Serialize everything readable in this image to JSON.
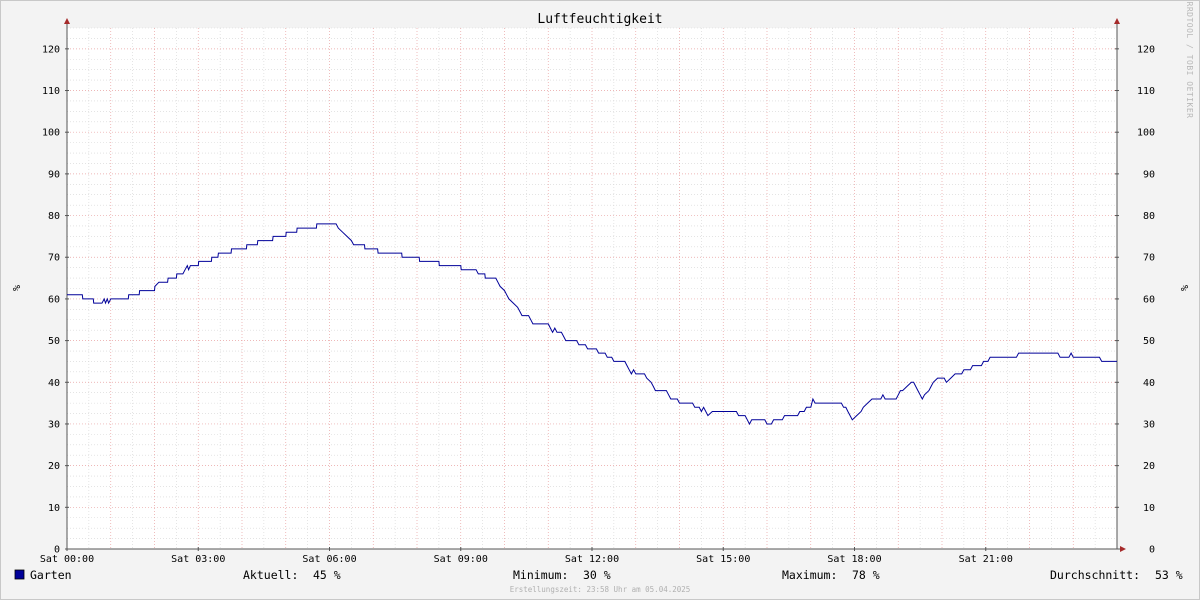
{
  "chart_data": {
    "type": "line",
    "title": "Luftfeuchtigkeit",
    "ylabel": "%",
    "ylim": [
      0,
      125
    ],
    "y_ticks": [
      0,
      10,
      20,
      30,
      40,
      50,
      60,
      70,
      80,
      90,
      100,
      110,
      120
    ],
    "xlim": [
      0,
      24
    ],
    "x_ticks": [
      {
        "x": 0,
        "label": "Sat 00:00"
      },
      {
        "x": 3,
        "label": "Sat 03:00"
      },
      {
        "x": 6,
        "label": "Sat 06:00"
      },
      {
        "x": 9,
        "label": "Sat 09:00"
      },
      {
        "x": 12,
        "label": "Sat 12:00"
      },
      {
        "x": 15,
        "label": "Sat 15:00"
      },
      {
        "x": 18,
        "label": "Sat 18:00"
      },
      {
        "x": 21,
        "label": "Sat 21:00"
      }
    ],
    "grid": true,
    "series": [
      {
        "name": "Garten",
        "color": "#000099",
        "points": [
          [
            0.0,
            61
          ],
          [
            0.35,
            61
          ],
          [
            0.36,
            60
          ],
          [
            0.6,
            60
          ],
          [
            0.61,
            59
          ],
          [
            0.8,
            59
          ],
          [
            0.85,
            60
          ],
          [
            0.88,
            59
          ],
          [
            0.92,
            60
          ],
          [
            0.95,
            59
          ],
          [
            1.0,
            60
          ],
          [
            1.4,
            60
          ],
          [
            1.41,
            61
          ],
          [
            1.65,
            61
          ],
          [
            1.66,
            62
          ],
          [
            2.0,
            62
          ],
          [
            2.01,
            63
          ],
          [
            2.1,
            64
          ],
          [
            2.3,
            64
          ],
          [
            2.31,
            65
          ],
          [
            2.5,
            65
          ],
          [
            2.51,
            66
          ],
          [
            2.65,
            66
          ],
          [
            2.7,
            67
          ],
          [
            2.75,
            68
          ],
          [
            2.78,
            67
          ],
          [
            2.82,
            68
          ],
          [
            3.0,
            68
          ],
          [
            3.01,
            69
          ],
          [
            3.3,
            69
          ],
          [
            3.31,
            70
          ],
          [
            3.45,
            70
          ],
          [
            3.46,
            71
          ],
          [
            3.75,
            71
          ],
          [
            3.76,
            72
          ],
          [
            4.1,
            72
          ],
          [
            4.11,
            73
          ],
          [
            4.35,
            73
          ],
          [
            4.36,
            74
          ],
          [
            4.7,
            74
          ],
          [
            4.71,
            75
          ],
          [
            5.0,
            75
          ],
          [
            5.01,
            76
          ],
          [
            5.25,
            76
          ],
          [
            5.26,
            77
          ],
          [
            5.7,
            77
          ],
          [
            5.71,
            78
          ],
          [
            6.15,
            78
          ],
          [
            6.2,
            77
          ],
          [
            6.3,
            76
          ],
          [
            6.4,
            75
          ],
          [
            6.5,
            74
          ],
          [
            6.55,
            73
          ],
          [
            6.8,
            73
          ],
          [
            6.81,
            72
          ],
          [
            7.1,
            72
          ],
          [
            7.11,
            71
          ],
          [
            7.65,
            71
          ],
          [
            7.66,
            70
          ],
          [
            8.05,
            70
          ],
          [
            8.06,
            69
          ],
          [
            8.5,
            69
          ],
          [
            8.51,
            68
          ],
          [
            9.0,
            68
          ],
          [
            9.01,
            67
          ],
          [
            9.35,
            67
          ],
          [
            9.4,
            66
          ],
          [
            9.55,
            66
          ],
          [
            9.56,
            65
          ],
          [
            9.8,
            65
          ],
          [
            9.85,
            64
          ],
          [
            9.9,
            63
          ],
          [
            10.0,
            62
          ],
          [
            10.05,
            61
          ],
          [
            10.1,
            60
          ],
          [
            10.2,
            59
          ],
          [
            10.3,
            58
          ],
          [
            10.35,
            57
          ],
          [
            10.4,
            56
          ],
          [
            10.55,
            56
          ],
          [
            10.6,
            55
          ],
          [
            10.65,
            54
          ],
          [
            11.0,
            54
          ],
          [
            11.05,
            53
          ],
          [
            11.1,
            52
          ],
          [
            11.15,
            53
          ],
          [
            11.2,
            52
          ],
          [
            11.3,
            52
          ],
          [
            11.35,
            51
          ],
          [
            11.4,
            50
          ],
          [
            11.65,
            50
          ],
          [
            11.7,
            49
          ],
          [
            11.85,
            49
          ],
          [
            11.9,
            48
          ],
          [
            12.1,
            48
          ],
          [
            12.15,
            47
          ],
          [
            12.3,
            47
          ],
          [
            12.35,
            46
          ],
          [
            12.45,
            46
          ],
          [
            12.5,
            45
          ],
          [
            12.75,
            45
          ],
          [
            12.8,
            44
          ],
          [
            12.85,
            43
          ],
          [
            12.9,
            42
          ],
          [
            12.95,
            43
          ],
          [
            13.0,
            42
          ],
          [
            13.2,
            42
          ],
          [
            13.25,
            41
          ],
          [
            13.35,
            40
          ],
          [
            13.4,
            39
          ],
          [
            13.45,
            38
          ],
          [
            13.7,
            38
          ],
          [
            13.75,
            37
          ],
          [
            13.8,
            36
          ],
          [
            13.95,
            36
          ],
          [
            14.0,
            35
          ],
          [
            14.3,
            35
          ],
          [
            14.35,
            34
          ],
          [
            14.45,
            34
          ],
          [
            14.5,
            33
          ],
          [
            14.55,
            34
          ],
          [
            14.6,
            33
          ],
          [
            14.65,
            32
          ],
          [
            14.75,
            33
          ],
          [
            15.3,
            33
          ],
          [
            15.35,
            32
          ],
          [
            15.5,
            32
          ],
          [
            15.55,
            31
          ],
          [
            15.6,
            30
          ],
          [
            15.65,
            31
          ],
          [
            15.95,
            31
          ],
          [
            16.0,
            30
          ],
          [
            16.1,
            30
          ],
          [
            16.15,
            31
          ],
          [
            16.35,
            31
          ],
          [
            16.4,
            32
          ],
          [
            16.7,
            32
          ],
          [
            16.75,
            33
          ],
          [
            16.85,
            33
          ],
          [
            16.9,
            34
          ],
          [
            17.0,
            34
          ],
          [
            17.05,
            36
          ],
          [
            17.1,
            35
          ],
          [
            17.7,
            35
          ],
          [
            17.75,
            34
          ],
          [
            17.8,
            34
          ],
          [
            17.85,
            33
          ],
          [
            17.9,
            32
          ],
          [
            17.95,
            31
          ],
          [
            18.05,
            32
          ],
          [
            18.15,
            33
          ],
          [
            18.2,
            34
          ],
          [
            18.3,
            35
          ],
          [
            18.4,
            36
          ],
          [
            18.6,
            36
          ],
          [
            18.65,
            37
          ],
          [
            18.7,
            36
          ],
          [
            18.95,
            36
          ],
          [
            19.0,
            37
          ],
          [
            19.05,
            38
          ],
          [
            19.1,
            38
          ],
          [
            19.2,
            39
          ],
          [
            19.3,
            40
          ],
          [
            19.35,
            40
          ],
          [
            19.45,
            38
          ],
          [
            19.5,
            37
          ],
          [
            19.55,
            36
          ],
          [
            19.6,
            37
          ],
          [
            19.7,
            38
          ],
          [
            19.75,
            39
          ],
          [
            19.8,
            40
          ],
          [
            19.9,
            41
          ],
          [
            20.05,
            41
          ],
          [
            20.1,
            40
          ],
          [
            20.2,
            41
          ],
          [
            20.3,
            42
          ],
          [
            20.45,
            42
          ],
          [
            20.5,
            43
          ],
          [
            20.65,
            43
          ],
          [
            20.7,
            44
          ],
          [
            20.9,
            44
          ],
          [
            20.95,
            45
          ],
          [
            21.05,
            45
          ],
          [
            21.1,
            46
          ],
          [
            21.7,
            46
          ],
          [
            21.75,
            47
          ],
          [
            22.65,
            47
          ],
          [
            22.7,
            46
          ],
          [
            22.9,
            46
          ],
          [
            22.95,
            47
          ],
          [
            23.0,
            46
          ],
          [
            23.6,
            46
          ],
          [
            23.65,
            45
          ],
          [
            24.0,
            45
          ]
        ]
      }
    ]
  },
  "legend": {
    "series_name": "Garten",
    "series_color": "#000099",
    "current_label": "Aktuell:",
    "current_value": "45 %",
    "min_label": "Minimum:",
    "min_value": "30 %",
    "max_label": "Maximum:",
    "max_value": "78 %",
    "avg_label": "Durchschnitt:",
    "avg_value": "53 %"
  },
  "footer": "Erstellungszeit: 23:58 Uhr am 05.04.2025",
  "watermark": "RRDTOOL / TOBI OETIKER"
}
